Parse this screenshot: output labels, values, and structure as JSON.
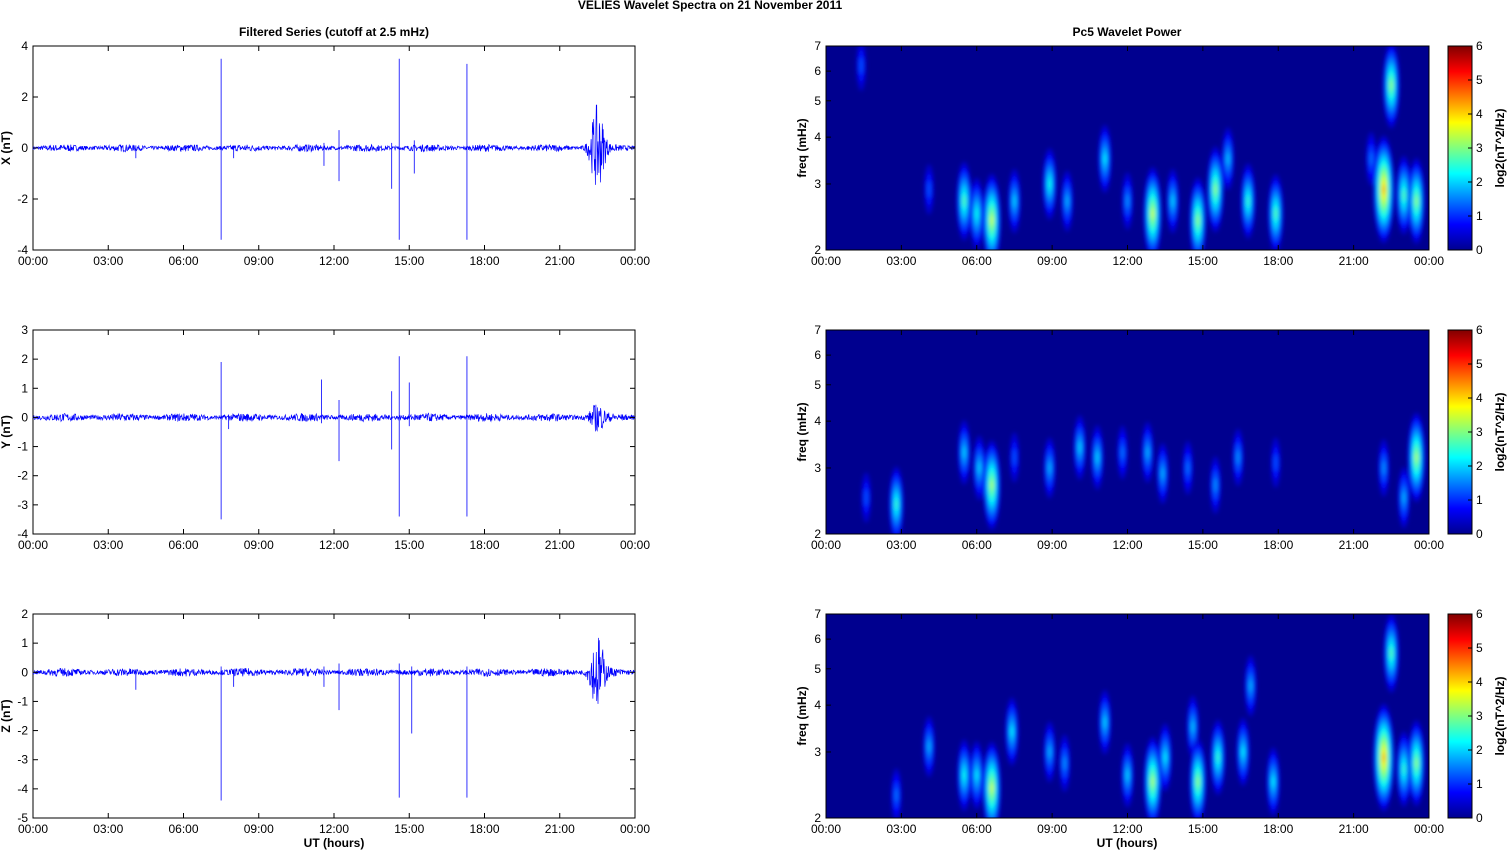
{
  "chart_data": {
    "title": "VELIES Wavelet Spectra on 21 November  2011",
    "left_title": "Filtered Series (cutoff at 2.5 mHz)",
    "right_title": "Pc5 Wavelet Power",
    "xlabel": "UT (hours)",
    "xticks": [
      "00:00",
      "03:00",
      "06:00",
      "09:00",
      "12:00",
      "15:00",
      "18:00",
      "21:00",
      "00:00"
    ],
    "xlim": [
      0,
      24
    ],
    "series_color": "#0000ff",
    "panels": [
      {
        "type": "line",
        "ylabel": "X (nT)",
        "ylim": [
          -4,
          4
        ],
        "yticks": [
          -4,
          -2,
          0,
          2,
          4
        ],
        "noise_amplitude": 0.12,
        "spikes": [
          [
            4.1,
            -0.4,
            0.1
          ],
          [
            7.5,
            -3.6,
            3.5
          ],
          [
            8.0,
            -0.4,
            0.1
          ],
          [
            11.6,
            -0.7,
            0.2
          ],
          [
            12.2,
            -1.3,
            0.7
          ],
          [
            14.3,
            -1.6,
            0.2
          ],
          [
            14.6,
            -3.6,
            3.5
          ],
          [
            15.2,
            -1.0,
            0.3
          ],
          [
            17.3,
            -3.6,
            3.3
          ]
        ],
        "burst": {
          "t": 22.5,
          "amp": 1.6
        }
      },
      {
        "type": "line",
        "ylabel": "Y (nT)",
        "ylim": [
          -4,
          3
        ],
        "yticks": [
          -4,
          -3,
          -2,
          -1,
          0,
          1,
          2,
          3
        ],
        "noise_amplitude": 0.12,
        "spikes": [
          [
            7.5,
            -3.5,
            1.9
          ],
          [
            7.8,
            -0.4,
            0.1
          ],
          [
            11.5,
            -0.2,
            1.3
          ],
          [
            12.2,
            -1.5,
            0.6
          ],
          [
            14.3,
            -1.1,
            0.9
          ],
          [
            14.6,
            -3.4,
            2.1
          ],
          [
            15.0,
            -0.3,
            1.2
          ],
          [
            17.3,
            -3.4,
            2.1
          ]
        ],
        "burst": {
          "t": 22.5,
          "amp": 0.4
        }
      },
      {
        "type": "line",
        "ylabel": "Z (nT)",
        "ylim": [
          -5,
          2
        ],
        "yticks": [
          -5,
          -4,
          -3,
          -2,
          -1,
          0,
          1,
          2
        ],
        "noise_amplitude": 0.12,
        "spikes": [
          [
            4.1,
            -0.6,
            0.1
          ],
          [
            7.5,
            -4.4,
            0.2
          ],
          [
            8.0,
            -0.5,
            0.1
          ],
          [
            11.6,
            -0.5,
            0.2
          ],
          [
            12.2,
            -1.3,
            0.3
          ],
          [
            14.6,
            -4.3,
            0.3
          ],
          [
            15.1,
            -2.1,
            0.2
          ],
          [
            17.3,
            -4.3,
            0.2
          ]
        ],
        "burst": {
          "t": 22.5,
          "amp": 1.2
        }
      }
    ],
    "spectra": [
      {
        "type": "heatmap",
        "ylabel": "freq (mHz)",
        "ylim": [
          2,
          7
        ],
        "yticks": [
          2,
          3,
          4,
          5,
          6,
          7
        ],
        "colorbar_label": "log2(nT^2/Hz)",
        "clim": [
          0,
          6
        ],
        "cticks": [
          0,
          1,
          2,
          3,
          4,
          5,
          6
        ],
        "blobs": [
          [
            1.4,
            6.2,
            0.8
          ],
          [
            4.1,
            2.9,
            0.8
          ],
          [
            5.5,
            2.7,
            2.4
          ],
          [
            6.0,
            2.5,
            2.0
          ],
          [
            6.6,
            2.4,
            3.2
          ],
          [
            7.5,
            2.7,
            1.6
          ],
          [
            8.9,
            3.0,
            2.0
          ],
          [
            9.6,
            2.7,
            1.4
          ],
          [
            11.1,
            3.5,
            1.8
          ],
          [
            12.0,
            2.7,
            1.2
          ],
          [
            13.0,
            2.5,
            3.2
          ],
          [
            13.8,
            2.7,
            1.6
          ],
          [
            14.8,
            2.4,
            2.8
          ],
          [
            15.5,
            2.9,
            2.8
          ],
          [
            16.0,
            3.5,
            1.5
          ],
          [
            16.8,
            2.7,
            2.2
          ],
          [
            17.9,
            2.5,
            2.4
          ],
          [
            21.7,
            3.5,
            1.0
          ],
          [
            22.2,
            2.9,
            4.0
          ],
          [
            22.5,
            5.5,
            2.8
          ],
          [
            23.0,
            2.8,
            2.4
          ],
          [
            23.5,
            2.7,
            2.8
          ]
        ]
      },
      {
        "type": "heatmap",
        "ylabel": "freq (mHz)",
        "ylim": [
          2,
          7
        ],
        "yticks": [
          2,
          3,
          4,
          5,
          6,
          7
        ],
        "colorbar_label": "log2(nT^2/Hz)",
        "clim": [
          0,
          6
        ],
        "cticks": [
          0,
          1,
          2,
          3,
          4,
          5,
          6
        ],
        "blobs": [
          [
            1.6,
            2.5,
            0.8
          ],
          [
            2.8,
            2.4,
            2.2
          ],
          [
            5.5,
            3.3,
            1.6
          ],
          [
            6.1,
            3.0,
            1.6
          ],
          [
            6.6,
            2.7,
            3.0
          ],
          [
            7.5,
            3.2,
            0.8
          ],
          [
            8.9,
            3.0,
            1.4
          ],
          [
            10.1,
            3.4,
            1.6
          ],
          [
            10.8,
            3.2,
            1.6
          ],
          [
            11.8,
            3.3,
            1.0
          ],
          [
            12.8,
            3.3,
            1.4
          ],
          [
            13.4,
            2.9,
            1.4
          ],
          [
            14.4,
            3.0,
            1.0
          ],
          [
            15.5,
            2.7,
            1.2
          ],
          [
            16.4,
            3.2,
            1.2
          ],
          [
            17.9,
            3.1,
            0.8
          ],
          [
            22.2,
            3.0,
            1.2
          ],
          [
            23.0,
            2.5,
            1.4
          ],
          [
            23.5,
            3.2,
            3.0
          ]
        ]
      },
      {
        "type": "heatmap",
        "ylabel": "freq (mHz)",
        "ylim": [
          2,
          7
        ],
        "yticks": [
          2,
          3,
          4,
          5,
          6,
          7
        ],
        "colorbar_label": "log2(nT^2/Hz)",
        "clim": [
          0,
          6
        ],
        "cticks": [
          0,
          1,
          2,
          3,
          4,
          5,
          6
        ],
        "blobs": [
          [
            2.8,
            2.3,
            1.0
          ],
          [
            4.1,
            3.1,
            1.4
          ],
          [
            5.5,
            2.6,
            2.0
          ],
          [
            6.0,
            2.6,
            1.8
          ],
          [
            6.6,
            2.4,
            3.2
          ],
          [
            7.4,
            3.4,
            1.8
          ],
          [
            8.9,
            3.0,
            1.4
          ],
          [
            9.5,
            2.8,
            1.2
          ],
          [
            11.1,
            3.6,
            1.6
          ],
          [
            12.0,
            2.6,
            1.6
          ],
          [
            13.0,
            2.5,
            3.0
          ],
          [
            13.5,
            2.9,
            1.8
          ],
          [
            14.6,
            3.5,
            1.5
          ],
          [
            14.8,
            2.5,
            2.8
          ],
          [
            15.6,
            2.9,
            2.2
          ],
          [
            16.6,
            3.0,
            1.8
          ],
          [
            16.9,
            4.5,
            1.4
          ],
          [
            17.8,
            2.5,
            1.8
          ],
          [
            22.2,
            2.9,
            4.0
          ],
          [
            22.5,
            5.5,
            2.4
          ],
          [
            23.0,
            2.7,
            2.2
          ],
          [
            23.5,
            2.8,
            2.8
          ]
        ]
      }
    ]
  }
}
